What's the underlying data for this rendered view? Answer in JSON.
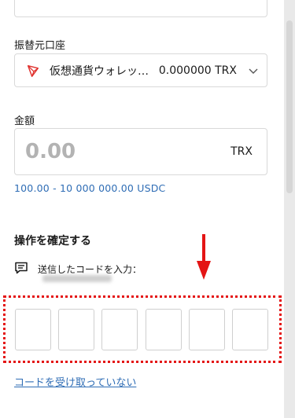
{
  "source": {
    "label": "振替元口座",
    "wallet_name": "仮想通貨ウォレッ…",
    "balance": "0.000000 TRX"
  },
  "amount": {
    "label": "金額",
    "value": "0.00",
    "currency": "TRX",
    "range": "100.00 - 10 000 000.00 USDC"
  },
  "confirm": {
    "title": "操作を確定する",
    "send_label": "送信したコードを入力：",
    "code_fields": [
      "",
      "",
      "",
      "",
      "",
      ""
    ],
    "resend_link": "コードを受け取っていない"
  },
  "icons": {
    "source_currency": "tron-icon",
    "dropdown": "chevron-down-icon",
    "message": "message-icon",
    "pointer": "red-arrow-down"
  },
  "colors": {
    "link": "#2f6db5",
    "tron": "#e0302c",
    "highlight": "#e41414",
    "placeholder": "#b3b3b3"
  }
}
